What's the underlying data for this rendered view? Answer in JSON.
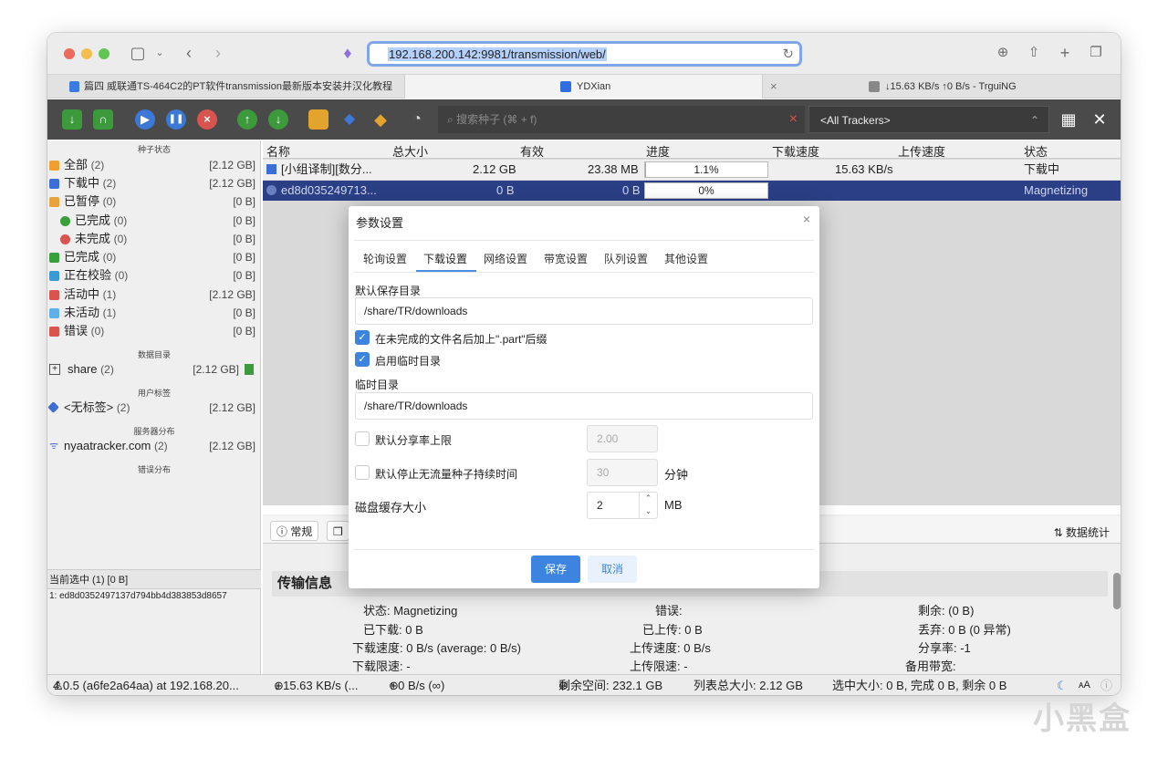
{
  "browser": {
    "url": "192.168.200.142:9981/transmission/web/",
    "tabs": [
      {
        "label": "篇四 威联通TS-464C2的PT软件transmission最新版本安装并汉化教程"
      },
      {
        "label": "YDXian"
      },
      {
        "label": "↓15.63 KB/s ↑0 B/s - TrguiNG"
      }
    ]
  },
  "toolbar": {
    "search_placeholder": "搜索种子 (⌘ + f)",
    "tracker_filter": "<All Trackers>"
  },
  "sidebar": {
    "status_header": "种子状态",
    "status_items": [
      {
        "label": "全部",
        "count": "(2)",
        "size": "[2.12 GB]",
        "color": "#f0a030"
      },
      {
        "label": "下载中",
        "count": "(2)",
        "size": "[2.12 GB]",
        "color": "#3b6fd6"
      },
      {
        "label": "已暂停",
        "count": "(0)",
        "size": "[0 B]",
        "color": "#e8a33a"
      },
      {
        "label": "已完成",
        "count": "(0)",
        "size": "[0 B]",
        "color": "#38a03a"
      },
      {
        "label": "未完成",
        "count": "(0)",
        "size": "[0 B]",
        "color": "#d9534f"
      },
      {
        "label": "已完成",
        "count": "(0)",
        "size": "[0 B]",
        "color": "#38a03a"
      },
      {
        "label": "正在校验",
        "count": "(0)",
        "size": "[0 B]",
        "color": "#3b9ad6"
      },
      {
        "label": "活动中",
        "count": "(1)",
        "size": "[2.12 GB]",
        "color": "#d9534f"
      },
      {
        "label": "未活动",
        "count": "(1)",
        "size": "[0 B]",
        "color": "#5fb0e8"
      },
      {
        "label": "错误",
        "count": "(0)",
        "size": "[0 B]",
        "color": "#d9534f"
      }
    ],
    "dir_header": "数据目录",
    "dir_item": {
      "label": "share",
      "count": "(2)",
      "size": "[2.12 GB]"
    },
    "label_header": "用户标签",
    "label_item": {
      "label": "<无标签>",
      "count": "(2)",
      "size": "[2.12 GB]"
    },
    "server_header": "服务器分布",
    "server_item": {
      "label": "nyaatracker.com",
      "count": "(2)",
      "size": "[2.12 GB]"
    },
    "error_header": "错误分布",
    "selected_header": "当前选中 (1) [0 B]",
    "selected_line": "1: ed8d0352497137d794bb4d383853d8657"
  },
  "list": {
    "columns": [
      "名称",
      "总大小",
      "有效",
      "进度",
      "下载速度",
      "上传速度",
      "状态"
    ],
    "rows": [
      {
        "name": "[小组译制][数分...",
        "size": "2.12 GB",
        "valid": "23.38 MB",
        "progress": "1.1%",
        "progress_value": 1.1,
        "down": "15.63 KB/s",
        "up": "",
        "status": "下载中"
      },
      {
        "name": "ed8d035249713...",
        "size": "0 B",
        "valid": "0 B",
        "progress": "0%",
        "progress_value": 0,
        "down": "",
        "up": "",
        "status": "Magnetizing"
      }
    ]
  },
  "detail": {
    "tab_general": "常规",
    "stats_label": "数据统计",
    "section_title": "传输信息",
    "fields": {
      "status": "状态: Magnetizing",
      "error": "错误:",
      "remaining": "剩余: (0 B)",
      "downloaded": "已下载: 0 B",
      "uploaded": "已上传: 0 B",
      "discarded": "丢弃: 0 B (0 异常)",
      "down_speed": "下载速度: 0 B/s (average: 0 B/s)",
      "up_speed": "上传速度: 0 B/s",
      "ratio": "分享率: -1",
      "down_limit": "下载限速: -",
      "up_limit": "上传限速: -",
      "backup_bw": "备用带宽:"
    }
  },
  "statusbar": {
    "version": "4.0.5 (a6fe2a64aa) at 192.168.20...",
    "down": "↓ 15.63 KB/s (...",
    "up": "↑ 0 B/s (∞)",
    "free_space": "剩余空间: 232.1 GB",
    "list_total": "列表总大小: 2.12 GB",
    "selected": "选中大小: 0 B, 完成 0 B, 剩余 0 B"
  },
  "dialog": {
    "title": "参数设置",
    "tabs": [
      "轮询设置",
      "下载设置",
      "网络设置",
      "带宽设置",
      "队列设置",
      "其他设置"
    ],
    "active_tab": "下载设置",
    "default_dir_label": "默认保存目录",
    "default_dir_value": "/share/TR/downloads",
    "part_suffix_label": "在未完成的文件名后加上\".part\"后缀",
    "part_suffix_checked": true,
    "temp_dir_enable_label": "启用临时目录",
    "temp_dir_enable_checked": true,
    "temp_dir_label": "临时目录",
    "temp_dir_value": "/share/TR/downloads",
    "ratio_limit_label": "默认分享率上限",
    "ratio_limit_checked": false,
    "ratio_limit_value": "2.00",
    "idle_limit_label": "默认停止无流量种子持续时间",
    "idle_limit_checked": false,
    "idle_limit_value": "30",
    "idle_unit": "分钟",
    "cache_label": "磁盘缓存大小",
    "cache_value": "2",
    "cache_unit": "MB",
    "save": "保存",
    "cancel": "取消"
  },
  "watermark": "小黑盒"
}
